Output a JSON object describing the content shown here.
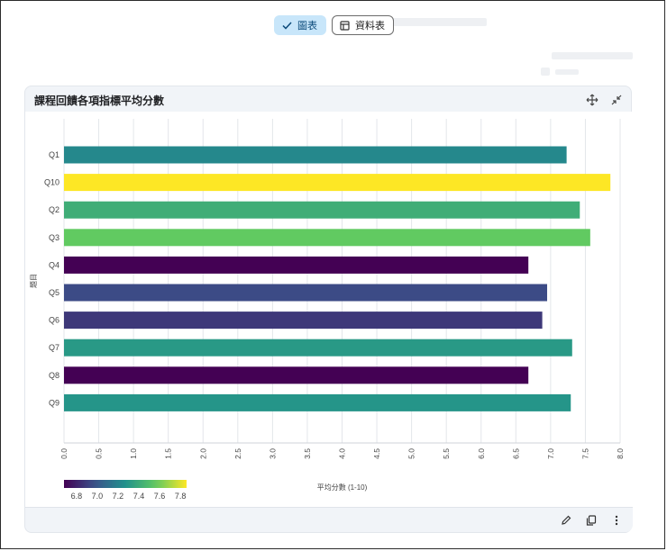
{
  "toggle": {
    "chart_label": "圖表",
    "table_label": "資料表"
  },
  "card": {
    "title": "課程回饋各項指標平均分數"
  },
  "icons": {
    "chart_toggle": "check-icon",
    "table_toggle": "table-icon",
    "move": "move-arrows-icon",
    "collapse": "collapse-icon",
    "edit": "pencil-icon",
    "copy": "copy-icon",
    "more": "more-vert-icon"
  },
  "chart_data": {
    "type": "bar",
    "orientation": "horizontal",
    "title": "",
    "xlabel": "平均分數 (1-10)",
    "ylabel": "題目",
    "xlim": [
      0,
      8
    ],
    "xticks": [
      "0.0",
      "0.5",
      "1.0",
      "1.5",
      "2.0",
      "2.5",
      "3.0",
      "3.5",
      "4.0",
      "4.5",
      "5.0",
      "5.5",
      "6.0",
      "6.5",
      "7.0",
      "7.5",
      "8.0"
    ],
    "categories": [
      "Q1",
      "Q10",
      "Q2",
      "Q3",
      "Q4",
      "Q5",
      "Q6",
      "Q7",
      "Q8",
      "Q9"
    ],
    "values": [
      7.23,
      7.86,
      7.42,
      7.57,
      6.68,
      6.95,
      6.88,
      7.31,
      6.68,
      7.29
    ],
    "grid": "vertical",
    "colorscale": "viridis",
    "colorbar": {
      "range": [
        6.68,
        7.86
      ],
      "ticks": [
        "6.8",
        "7.0",
        "7.2",
        "7.4",
        "7.6",
        "7.8"
      ]
    }
  }
}
